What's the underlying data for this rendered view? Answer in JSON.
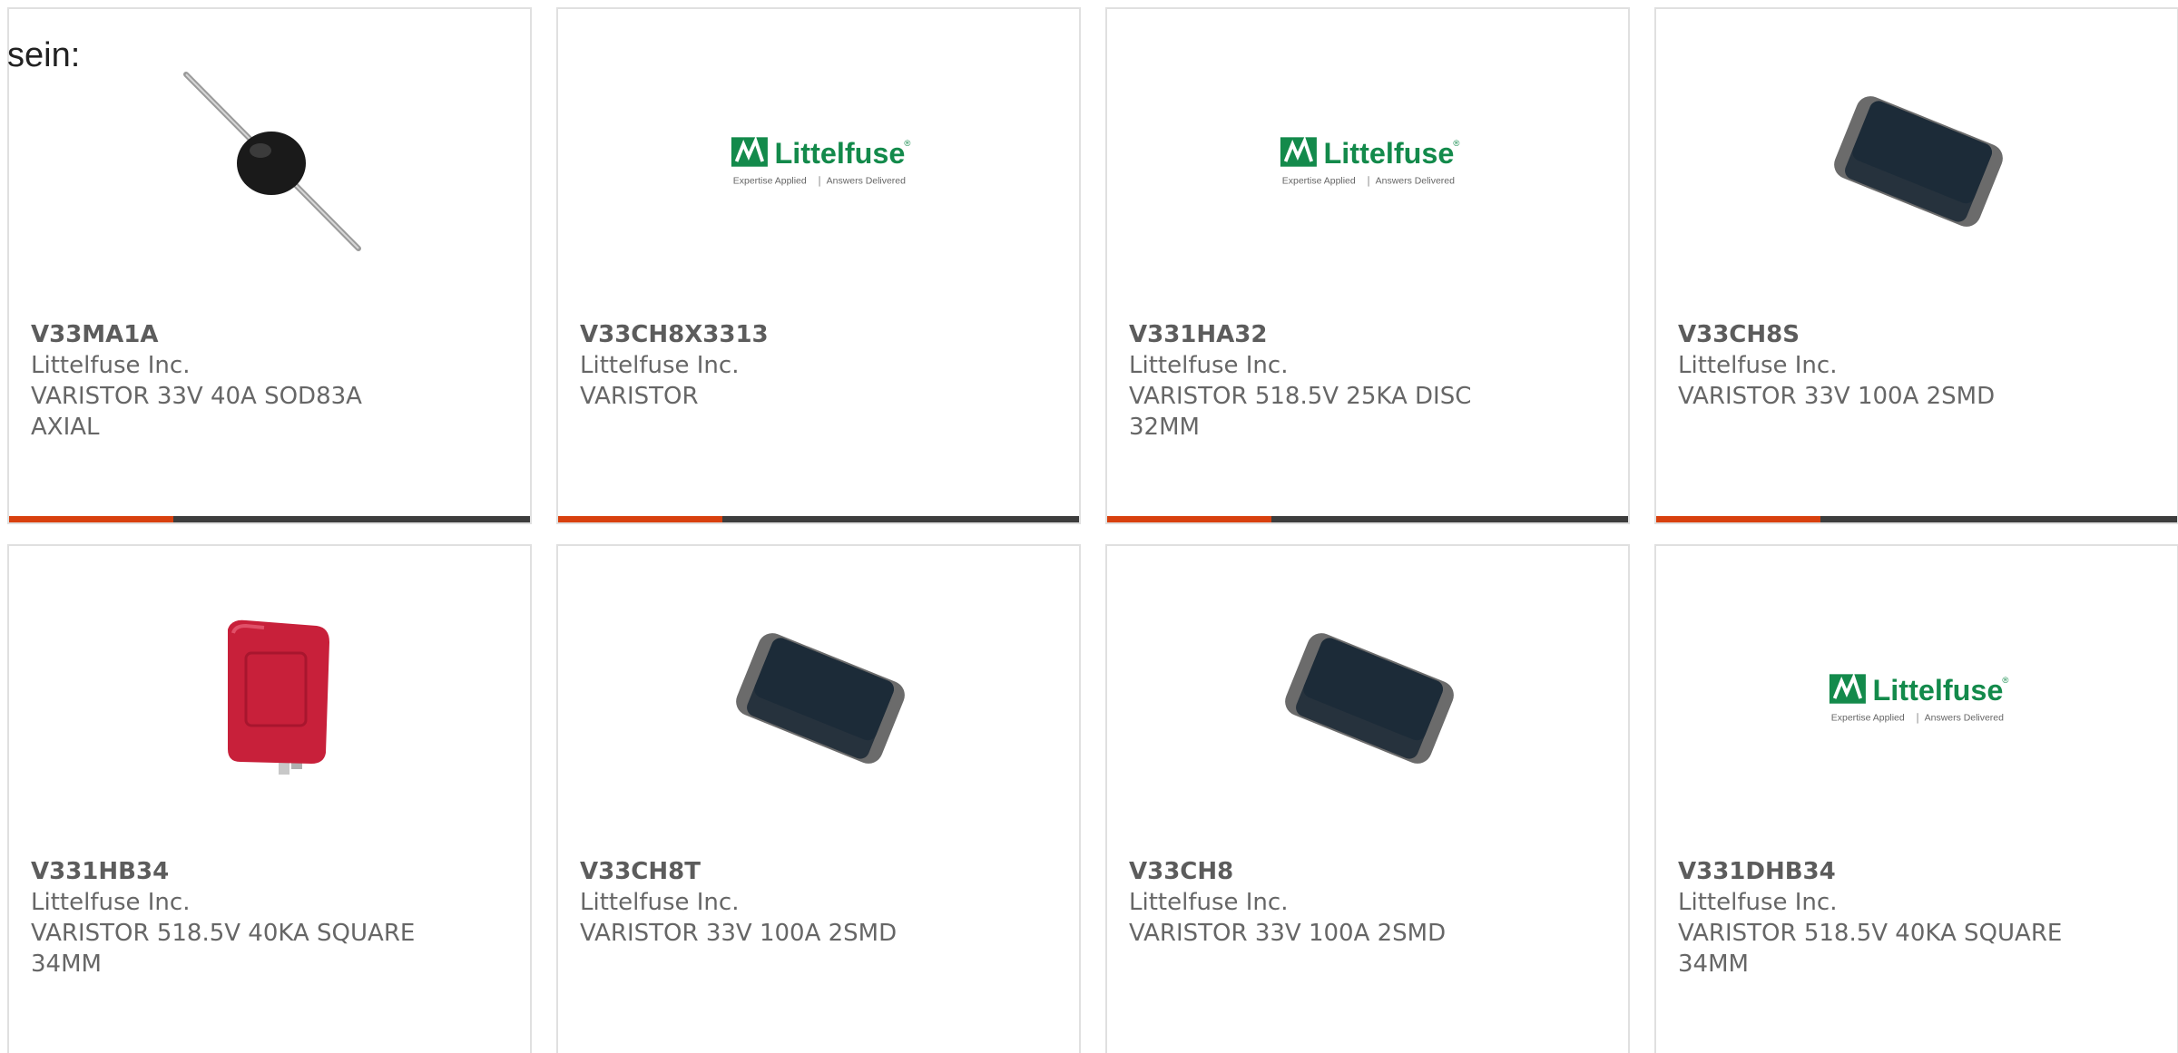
{
  "intro_text": "sein:",
  "colors": {
    "accent": "#d8400e",
    "bar": "#3d3d3d",
    "logo_green": "#138a4b"
  },
  "products": [
    {
      "part_number": "V33MA1A",
      "manufacturer": "Littelfuse Inc.",
      "description": "VARISTOR 33V 40A SOD83A AXIAL",
      "image": "axial-varistor-photo"
    },
    {
      "part_number": "V33CH8X3313",
      "manufacturer": "Littelfuse Inc.",
      "description": "VARISTOR",
      "image": "littelfuse-logo"
    },
    {
      "part_number": "V331HA32",
      "manufacturer": "Littelfuse Inc.",
      "description": "VARISTOR 518.5V 25KA DISC 32MM",
      "image": "littelfuse-logo"
    },
    {
      "part_number": "V33CH8S",
      "manufacturer": "Littelfuse Inc.",
      "description": "VARISTOR 33V 100A 2SMD",
      "image": "smd-chip-photo"
    },
    {
      "part_number": "V331HB34",
      "manufacturer": "Littelfuse Inc.",
      "description": "VARISTOR 518.5V 40KA SQUARE 34MM",
      "image": "square-red-varistor-photo"
    },
    {
      "part_number": "V33CH8T",
      "manufacturer": "Littelfuse Inc.",
      "description": "VARISTOR 33V 100A 2SMD",
      "image": "smd-chip-photo"
    },
    {
      "part_number": "V33CH8",
      "manufacturer": "Littelfuse Inc.",
      "description": "VARISTOR 33V 100A 2SMD",
      "image": "smd-chip-photo"
    },
    {
      "part_number": "V331DHB34",
      "manufacturer": "Littelfuse Inc.",
      "description": "VARISTOR 518.5V 40KA SQUARE 34MM",
      "image": "littelfuse-logo"
    }
  ],
  "logo": {
    "wordmark": "Littelfuse",
    "registered": "®",
    "tagline_left": "Expertise Applied",
    "tagline_right": "Answers Delivered"
  }
}
